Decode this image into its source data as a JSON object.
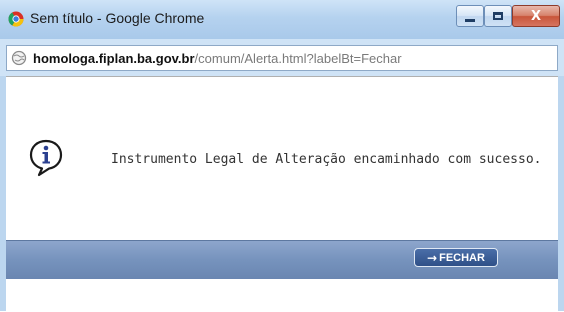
{
  "window": {
    "title": "Sem título - Google Chrome",
    "controls": {
      "minimize": "–",
      "maximize": "□",
      "close": "X"
    }
  },
  "address_bar": {
    "url_host": "homologa.fiplan.ba.gov.br",
    "url_path": "/comum/Alerta.html?labelBt=Fechar"
  },
  "alert": {
    "icon": "info-icon",
    "message": "Instrumento Legal de Alteração encaminhado com sucesso.",
    "button_arrow": "→",
    "button_label": "FECHAR"
  },
  "colors": {
    "titlebar": "#b5d2ef",
    "footer_bar": "#7693bd",
    "button": "#2f5088"
  }
}
